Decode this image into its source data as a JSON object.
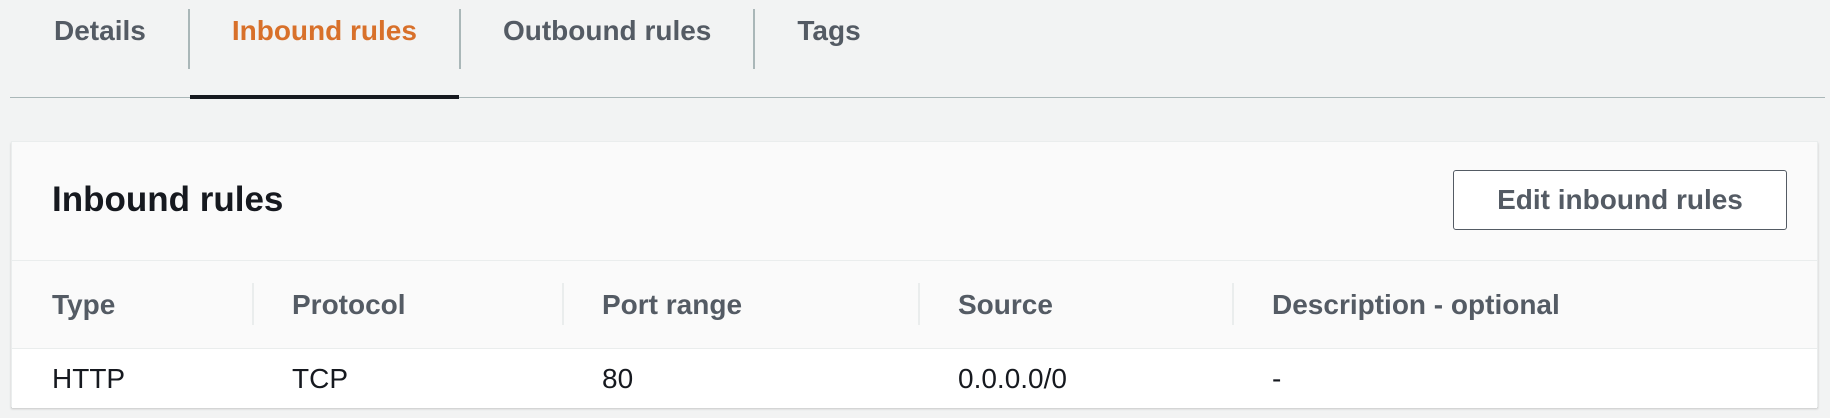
{
  "tabs": [
    {
      "label": "Details",
      "active": false
    },
    {
      "label": "Inbound rules",
      "active": true
    },
    {
      "label": "Outbound rules",
      "active": false
    },
    {
      "label": "Tags",
      "active": false
    }
  ],
  "panel": {
    "title": "Inbound rules",
    "edit_button_label": "Edit inbound rules"
  },
  "table": {
    "columns": [
      "Type",
      "Protocol",
      "Port range",
      "Source",
      "Description - optional"
    ],
    "rows": [
      [
        "HTTP",
        "TCP",
        "80",
        "0.0.0.0/0",
        "-"
      ]
    ]
  },
  "colors": {
    "active_tab": "#d8702a",
    "tab_text": "#545b64",
    "page_background": "#f2f3f3",
    "panel_background": "#fafafa"
  }
}
